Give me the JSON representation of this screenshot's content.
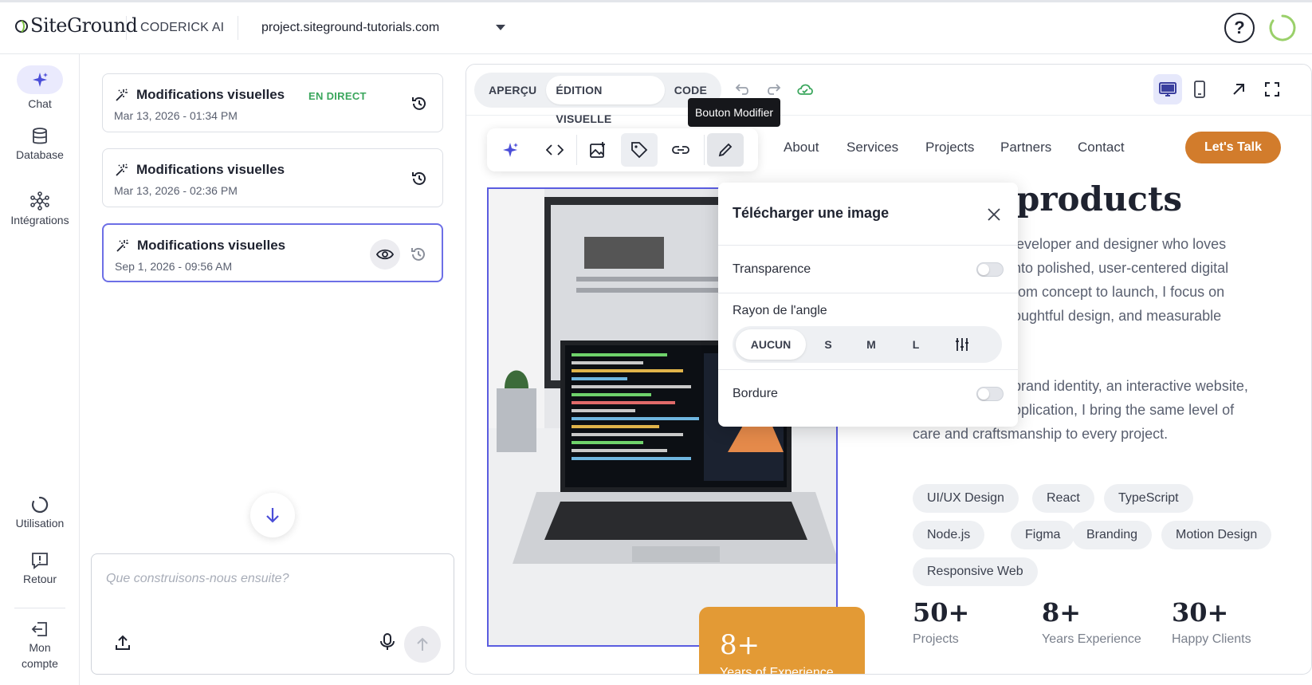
{
  "header": {
    "logo_text": "SiteGround",
    "product": "CODERICK AI",
    "site": "project.siteground-tutorials.com",
    "help": "?"
  },
  "leftnav": {
    "chat": "Chat",
    "database": "Database",
    "integrations": "Intégrations",
    "usage": "Utilisation",
    "feedback": "Retour",
    "account_line1": "Mon",
    "account_line2": "compte"
  },
  "history": {
    "items": [
      {
        "title": "Modifications visuelles",
        "badge": "EN DIRECT",
        "date": "Mar 13, 2026 - 01:34 PM"
      },
      {
        "title": "Modifications visuelles",
        "badge": "",
        "date": "Mar 13, 2026 - 02:36 PM"
      },
      {
        "title": "Modifications visuelles",
        "badge": "",
        "date": "Sep 1, 2026 - 09:56 AM"
      }
    ]
  },
  "composer": {
    "placeholder": "Que construisons-nous ensuite?"
  },
  "preview": {
    "tabs": [
      "APERÇU",
      "ÉDITION VISUELLE",
      "CODE"
    ],
    "active_tab": "ÉDITION VISUELLE",
    "tooltip": "Bouton Modifier"
  },
  "site": {
    "nav": [
      "About",
      "Services",
      "Projects",
      "Partners",
      "Contact"
    ],
    "cta": "Let's Talk",
    "headline": "products",
    "paragraph1": [
      "leveloper and designer who loves",
      "nto polished, user-centered digital",
      "rom concept to launch, I focus on",
      "oughtful design, and measurable"
    ],
    "paragraph2": [
      "brand identity, an interactive website,",
      "oplication, I bring the same level of",
      "care and craftsmanship to every project."
    ],
    "chips": [
      "UI/UX Design",
      "React",
      "TypeScript",
      "Node.js",
      "Figma",
      "Branding",
      "Motion Design",
      "Responsive Web"
    ],
    "badge_num": "8+",
    "badge_label": "Years of Experience",
    "stats": [
      {
        "num": "50+",
        "label": "Projects"
      },
      {
        "num": "8+",
        "label": "Years Experience"
      },
      {
        "num": "30+",
        "label": "Happy Clients"
      }
    ]
  },
  "popover": {
    "title": "Télécharger une image",
    "transparency": "Transparence",
    "radius": "Rayon de l'angle",
    "radius_options": [
      "AUCUN",
      "S",
      "M",
      "L"
    ],
    "radius_selected": "AUCUN",
    "border": "Bordure",
    "transparency_on": false,
    "border_on": false
  },
  "colors": {
    "accent": "#5a5ce0",
    "cta": "#d27c2c",
    "badge": "#e39a35",
    "live": "#3aa65c"
  }
}
